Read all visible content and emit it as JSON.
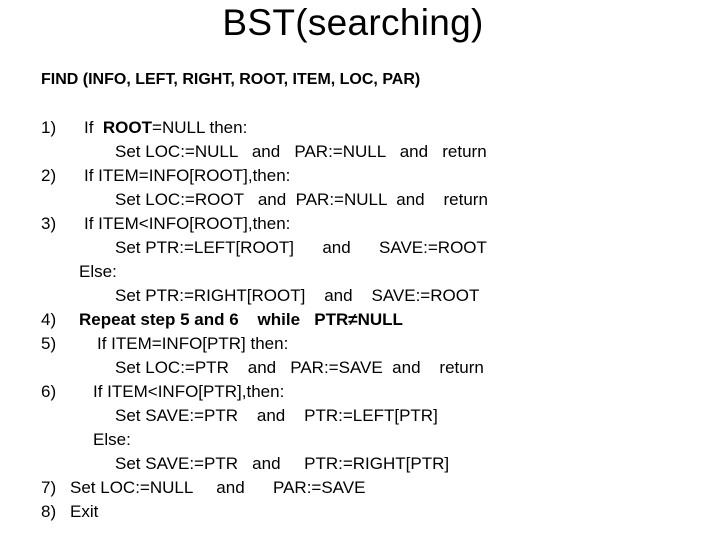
{
  "title": "BST(searching)",
  "signature": "FIND (INFO, LEFT, RIGHT, ROOT, ITEM, LOC, PAR)",
  "steps": {
    "s1": {
      "num": "1)",
      "pre": "If  ",
      "bold": "ROOT",
      "post": "=NULL then:",
      "body": "Set LOC:=NULL   and   PAR:=NULL   and   return"
    },
    "s2": {
      "num": "2)",
      "line": "If ITEM=INFO[ROOT],then:",
      "body": "Set LOC:=ROOT   and  PAR:=NULL  and    return"
    },
    "s3": {
      "num": "3)",
      "line": "If ITEM<INFO[ROOT],then:",
      "body": "Set PTR:=LEFT[ROOT]      and      SAVE:=ROOT",
      "else": "Else:",
      "else_body": "Set PTR:=RIGHT[ROOT]    and    SAVE:=ROOT"
    },
    "s4": {
      "num": "4)",
      "line": "Repeat step 5 and 6    while   PTR≠NULL"
    },
    "s5": {
      "num": "5)",
      "line": "If ITEM=INFO[PTR] then:",
      "body": "Set LOC:=PTR    and   PAR:=SAVE  and    return"
    },
    "s6": {
      "num": "6)",
      "line": "If ITEM<INFO[PTR],then:",
      "body": "Set SAVE:=PTR    and    PTR:=LEFT[PTR]",
      "else": "Else:",
      "else_body": "Set SAVE:=PTR   and     PTR:=RIGHT[PTR]"
    },
    "s7": {
      "num": "7)",
      "line": "Set LOC:=NULL     and      PAR:=SAVE"
    },
    "s8": {
      "num": "8)",
      "line": "Exit"
    }
  }
}
